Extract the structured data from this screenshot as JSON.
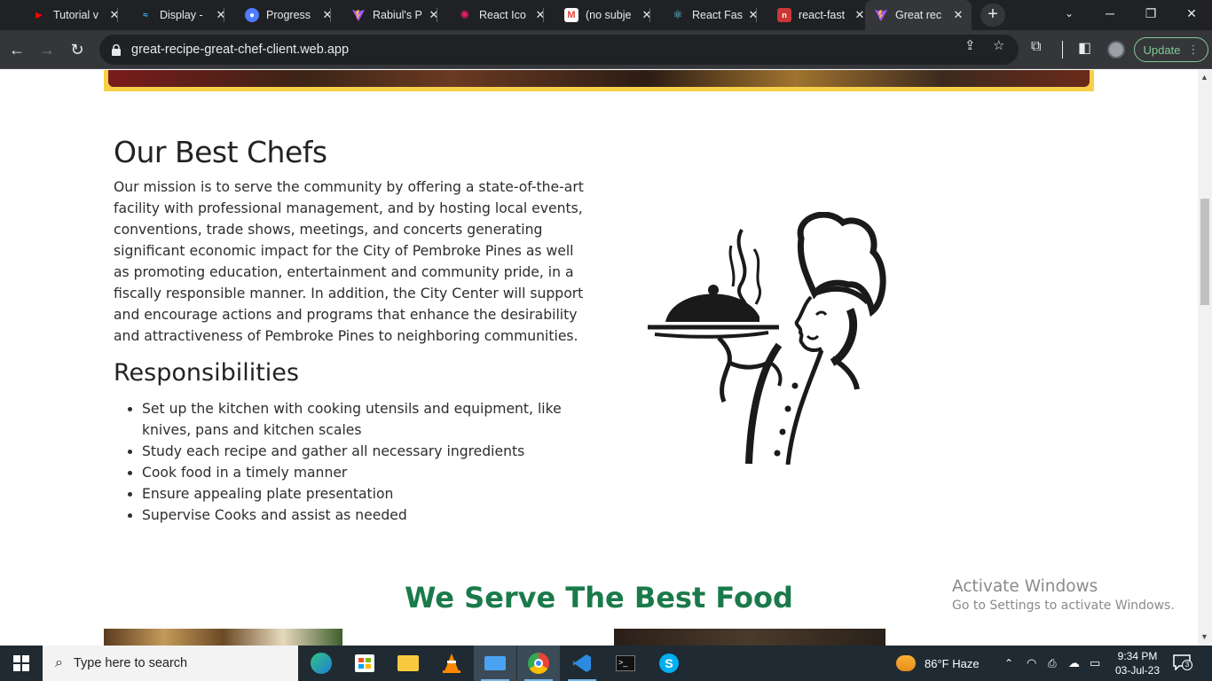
{
  "browser": {
    "tabs": [
      {
        "title": "Tutorial v",
        "favicon": "youtube-icon",
        "color": "#ff0000"
      },
      {
        "title": "Display -",
        "favicon": "tailwind-icon",
        "color": "#38bdf8"
      },
      {
        "title": "Progress",
        "favicon": "progress-icon",
        "color": "#4f7cff"
      },
      {
        "title": "Rabiul's P",
        "favicon": "vite-icon",
        "color": "#a855f7"
      },
      {
        "title": "React Ico",
        "favicon": "react-icons-icon",
        "color": "#e91e63"
      },
      {
        "title": "(no subje",
        "favicon": "gmail-icon",
        "color": "#ea4335"
      },
      {
        "title": "React Fas",
        "favicon": "react-icon",
        "color": "#61dafb"
      },
      {
        "title": "react-fast",
        "favicon": "npm-icon",
        "color": "#cb3837"
      },
      {
        "title": "Great rec",
        "favicon": "vite-icon",
        "color": "#a855f7",
        "active": true
      }
    ],
    "url": "great-recipe-great-chef-client.web.app",
    "update_label": "Update"
  },
  "page": {
    "chefs_title": "Our Best Chefs",
    "mission": "Our mission is to serve the community by offering a state-of-the-art facility with professional management, and by hosting local events, conventions, trade shows, meetings, and concerts generating significant economic impact for the City of Pembroke Pines as well as promoting education, entertainment and community pride, in a fiscally responsible manner. In addition, the City Center will support and encourage actions and programs that enhance the desirability and attractiveness of Pembroke Pines to neighboring communities.",
    "responsibilities_title": "Responsibilities",
    "responsibilities": [
      "Set up the kitchen with cooking utensils and equipment, like knives, pans and kitchen scales",
      "Study each recipe and gather all necessary ingredients",
      "Cook food in a timely manner",
      "Ensure appealing plate presentation",
      "Supervise Cooks and assist as needed"
    ],
    "serve_title": "We Serve The Best Food",
    "accent_color": "#1a7a4a",
    "banner_border_color": "#f8d047"
  },
  "watermark": {
    "line1": "Activate Windows",
    "line2": "Go to Settings to activate Windows."
  },
  "taskbar": {
    "search_placeholder": "Type here to search",
    "weather": "86°F  Haze",
    "time": "9:34 PM",
    "date": "03-Jul-23",
    "notification_count": "3"
  }
}
